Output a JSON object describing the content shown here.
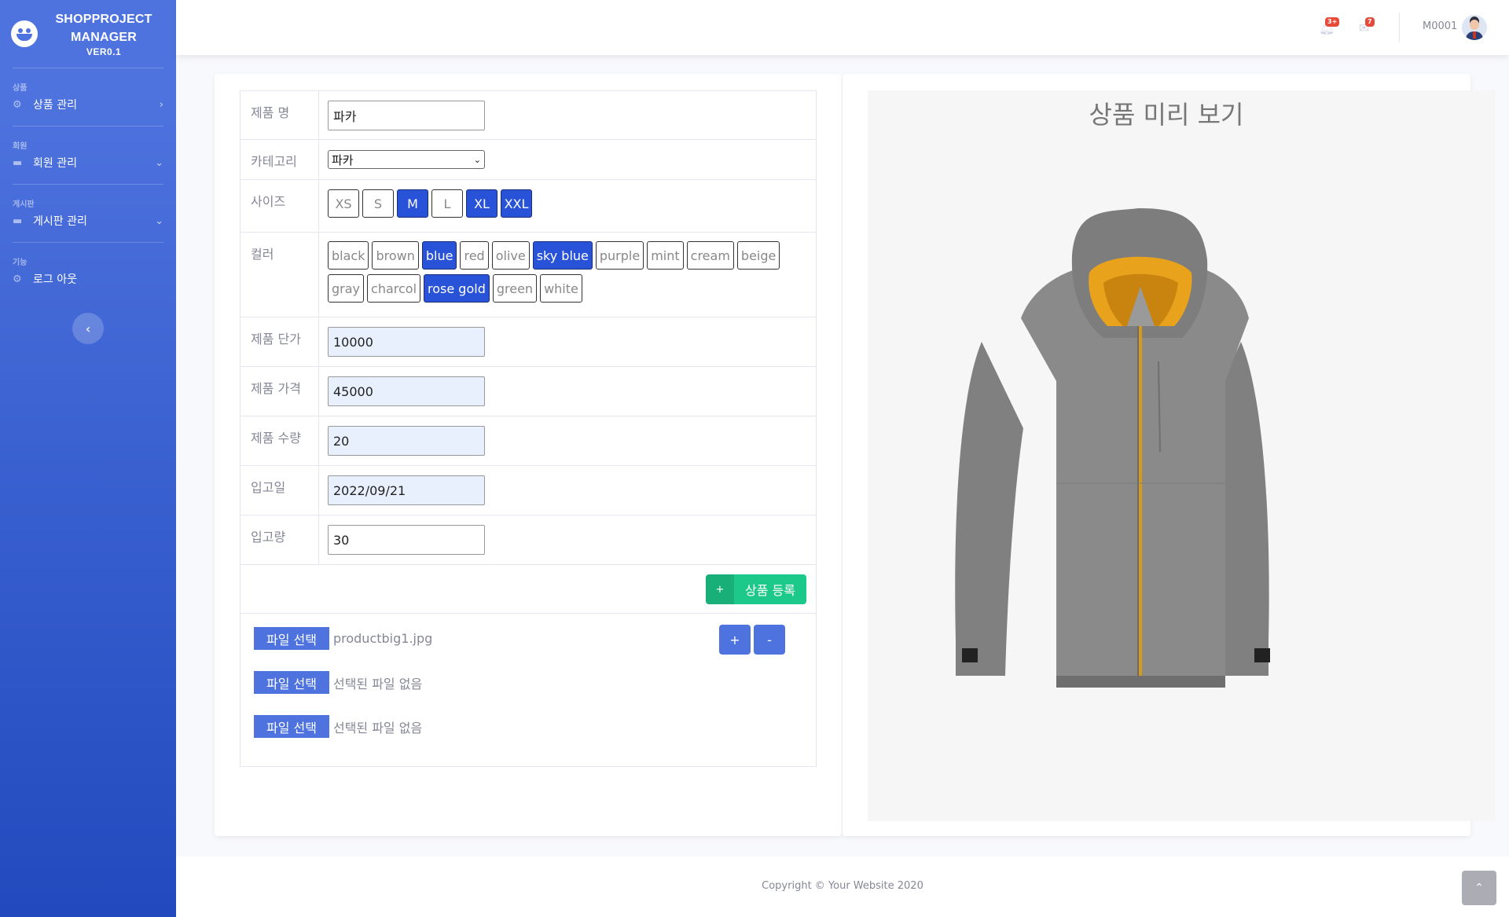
{
  "brand": {
    "line1": "SHOPPROJECT",
    "line2": "MANAGER",
    "version": "VER0.1"
  },
  "sidebar": {
    "sections": [
      {
        "heading": "상품",
        "item": "상품 관리",
        "icon": "gear-icon",
        "chevron": "›"
      },
      {
        "heading": "회원",
        "item": "회원 관리",
        "icon": "folder-icon",
        "chevron": "⌄"
      },
      {
        "heading": "게시판",
        "item": "게시판 관리",
        "icon": "folder-icon",
        "chevron": "⌄"
      },
      {
        "heading": "기능",
        "item": "로그 아웃",
        "icon": "gear-icon",
        "chevron": ""
      }
    ],
    "toggle": "‹"
  },
  "topbar": {
    "alerts_badge": "3+",
    "messages_badge": "7",
    "user": "M0001"
  },
  "form": {
    "name_label": "제품 명",
    "name_value": "파카",
    "category_label": "카테고리",
    "category_value": "파카",
    "size_label": "사이즈",
    "sizes": [
      {
        "label": "XS",
        "selected": false
      },
      {
        "label": "S",
        "selected": false
      },
      {
        "label": "M",
        "selected": true
      },
      {
        "label": "L",
        "selected": false
      },
      {
        "label": "XL",
        "selected": true
      },
      {
        "label": "XXL",
        "selected": true
      }
    ],
    "color_label": "컬러",
    "colors": [
      {
        "label": "black",
        "selected": false
      },
      {
        "label": "brown",
        "selected": false
      },
      {
        "label": "blue",
        "selected": true
      },
      {
        "label": "red",
        "selected": false
      },
      {
        "label": "olive",
        "selected": false
      },
      {
        "label": "sky blue",
        "selected": true
      },
      {
        "label": "purple",
        "selected": false
      },
      {
        "label": "mint",
        "selected": false
      },
      {
        "label": "cream",
        "selected": false
      },
      {
        "label": "beige",
        "selected": false
      },
      {
        "label": "gray",
        "selected": false
      },
      {
        "label": "charcol",
        "selected": false
      },
      {
        "label": "rose gold",
        "selected": true
      },
      {
        "label": "green",
        "selected": false
      },
      {
        "label": "white",
        "selected": false
      }
    ],
    "unit_price_label": "제품 단가",
    "unit_price_value": "10000",
    "price_label": "제품 가격",
    "price_value": "45000",
    "qty_label": "제품 수량",
    "qty_value": "20",
    "in_date_label": "입고일",
    "in_date_value": "2022/09/21",
    "in_qty_label": "입고량",
    "in_qty_value": "30",
    "register_plus": "+",
    "register_label": "상품 등록",
    "files": [
      {
        "button": "파일 선택",
        "name": "productbig1.jpg"
      },
      {
        "button": "파일 선택",
        "name": "선택된 파일 없음"
      },
      {
        "button": "파일 선택",
        "name": "선택된 파일 없음"
      }
    ],
    "add_label": "+",
    "remove_label": "-"
  },
  "preview": {
    "title": "상품 미리 보기"
  },
  "footer": {
    "copyright": "Copyright © Your Website 2020",
    "scroll_top": "⌃"
  },
  "colors": {
    "primary": "#4e73df",
    "success": "#1cc88a",
    "chip_selected": "#2853d9"
  }
}
